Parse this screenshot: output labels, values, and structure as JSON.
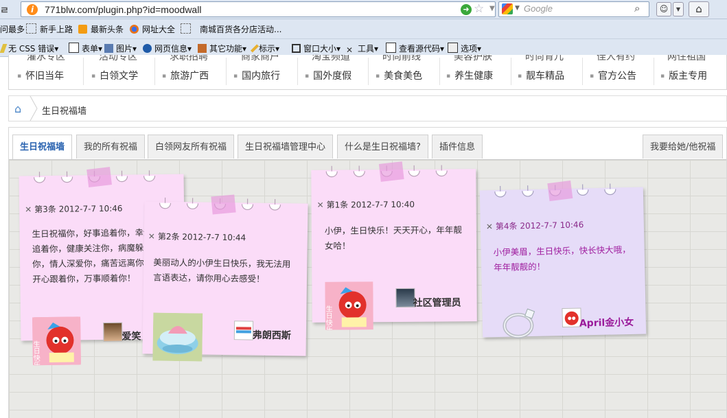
{
  "browser": {
    "url": "771blw.com/plugin.php?id=moodwall",
    "search_placeholder": "Google",
    "bookmarks": [
      "问最多",
      "新手上路",
      "最新头条",
      "网址大全",
      "南城百货各分店活动..."
    ],
    "toolbar": [
      "无 CSS 错误",
      "表单",
      "图片",
      "网页信息",
      "其它功能",
      "标示",
      "窗口大小",
      "工具",
      "查看源代码",
      "选项"
    ]
  },
  "site_nav": {
    "top_row_cut": [
      "灌水专区",
      "活动专区",
      "求职招聘",
      "商家商户",
      "淘宝频道",
      "时尚前线",
      "美容护肤",
      "时尚育儿",
      "佳人有约",
      "网住祖国"
    ],
    "items": [
      "怀旧当年",
      "白领文学",
      "旅游广西",
      "国内旅行",
      "国外度假",
      "美食美色",
      "养生健康",
      "靓车精品",
      "官方公告",
      "版主专用"
    ]
  },
  "breadcrumb": {
    "current": "生日祝福墙"
  },
  "tabs": {
    "items": [
      "生日祝福墙",
      "我的所有祝福",
      "白领网友所有祝福",
      "生日祝福墙管理中心",
      "什么是生日祝福墙?",
      "插件信息"
    ],
    "right": "我要给她/他祝福"
  },
  "notes": [
    {
      "meta": "第3条 2012-7-7 10:46",
      "message": "生日祝福你，好事追着你，幸运追着你，健康关注你，病魔躲着你，情人深爱你，痛苦远离你，开心跟着你，万事顺着你！",
      "user": "爱笑",
      "color": "#fbdcf8"
    },
    {
      "meta": "第2条 2012-7-7 10:44",
      "message": "美丽动人的小伊生日快乐，我无法用言语表达，请你用心去感受！",
      "user": "弗朗西斯",
      "color": "#fbdcf8"
    },
    {
      "meta": "第1条 2012-7-7 10:40",
      "message": "小伊，生日快乐！天天开心，年年靓女哈！",
      "user": "社区管理员",
      "color": "#fbdcf8"
    },
    {
      "meta": "第4条 2012-7-7 10:46",
      "message": "小伊美眉，生日快乐，快长快大哦，年年靓靓的！",
      "user": "April金小女",
      "color": "#e6dcf8"
    }
  ],
  "gift_labels": {
    "bday": "生日快乐"
  }
}
